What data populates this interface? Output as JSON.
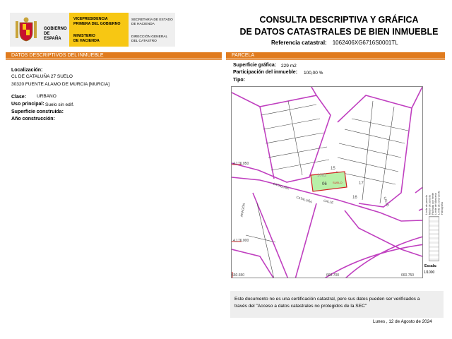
{
  "header": {
    "gobierno": [
      "GOBIERNO",
      "DE ESPAÑA"
    ],
    "vicepresidencia": [
      "VICEPRESIDENCIA",
      "PRIMERA DEL GOBIERNO"
    ],
    "ministerio": [
      "MINISTERIO",
      "DE HACIENDA"
    ],
    "secretaria": [
      "SECRETARÍA DE ESTADO",
      "DE HACIENDA"
    ],
    "direccion": [
      "DIRECCIÓN GENERAL",
      "DEL CATASTRO"
    ],
    "title_line1": "CONSULTA DESCRIPTIVA Y GRÁFICA",
    "title_line2": "DE DATOS CATASTRALES DE BIEN INMUEBLE",
    "ref_label": "Referencia catastral:",
    "ref_value": "1062406XG6716S0001TL"
  },
  "left": {
    "bar": "DATOS DESCRIPTIVOS DEL INMUEBLE",
    "localizacion_label": "Localización:",
    "address1": "CL DE CATALUÑA 27 SUELO",
    "address2": "30320 FUENTE ALAMO DE MURCIA [MURCIA]",
    "clase_label": "Clase:",
    "clase_value": "URBANO",
    "uso_label": "Uso principal:",
    "uso_value": "Suelo sin edif.",
    "superficie_label": "Superficie construida:",
    "ano_label": "Año construcción:"
  },
  "right": {
    "bar": "PARCELA",
    "sup_label": "Superficie gráfica:",
    "sup_value": "229 m2",
    "part_label": "Participación del inmueble:",
    "part_value": "100,00 %",
    "tipo_label": "Tipo:"
  },
  "map": {
    "parcel_numbers": [
      "15",
      "06",
      "17",
      "16",
      "1062",
      "SUELO"
    ],
    "streets": [
      "CATALUÑA",
      "CALLE",
      "ARAGÓN",
      "CATALUÑA",
      "CALLE"
    ],
    "coords": [
      "4.176.050",
      "4.176.000",
      "660.650",
      "660.700",
      "660.750"
    ],
    "legend": [
      "Límite de parcela",
      "Mojón de parcela",
      "Fachada con frente",
      "Límite de Manzana",
      "Límite de zona verde",
      "Hidrografía"
    ],
    "scale_label": "Escala:",
    "scale_value": "1/1000",
    "colors": {
      "parcel_line": "#c040c0",
      "highlight": "#b8f0a8",
      "orange": "#e07b1e"
    }
  },
  "notice": {
    "line1": "Este documento no es una certificación catastral, pero sus datos pueden ser verificados a",
    "line2": "través del \"Acceso a datos catastrales no protegidos de la SEC\""
  },
  "date": "Lunes , 12 de Agosto de 2024"
}
